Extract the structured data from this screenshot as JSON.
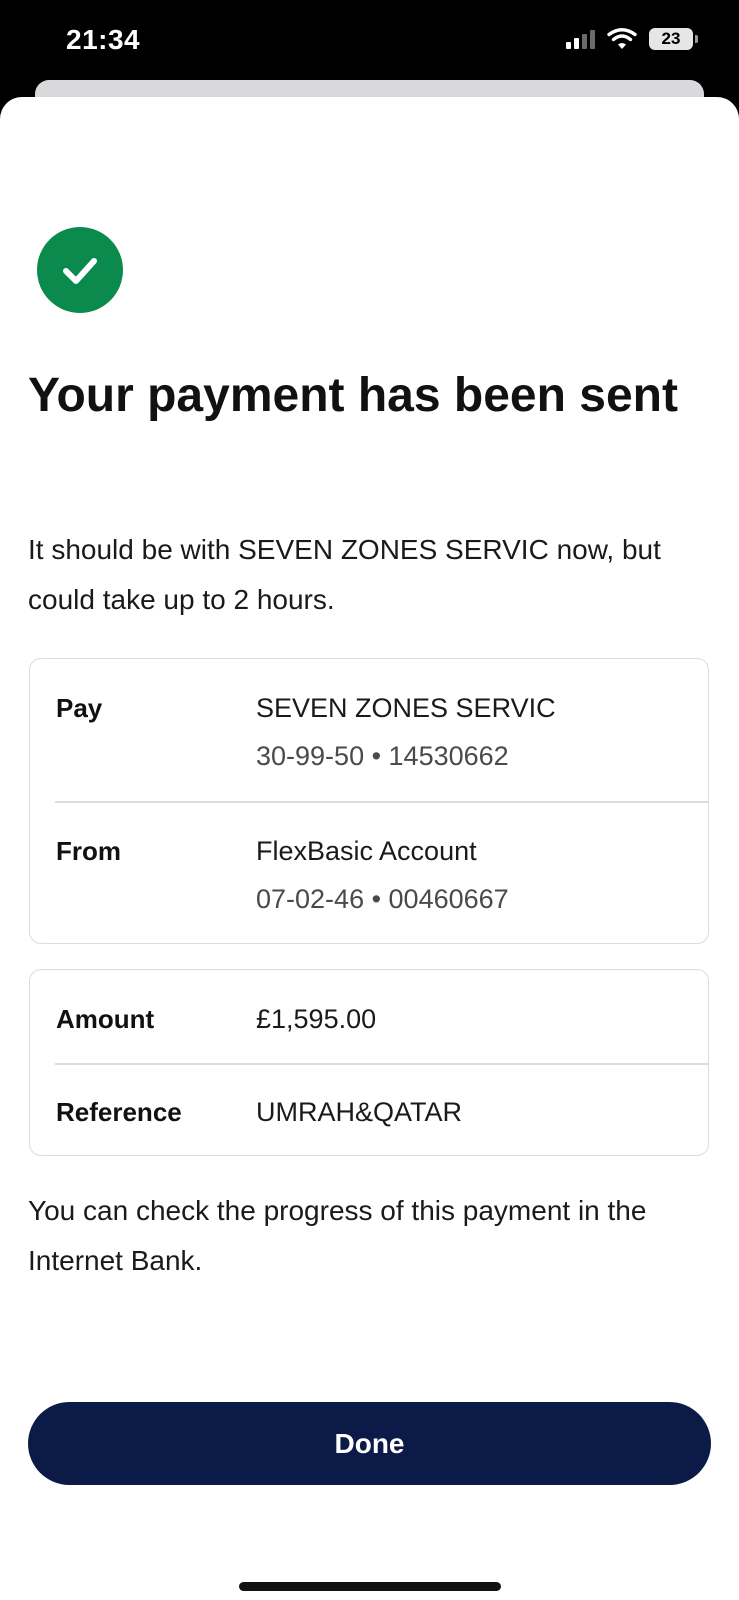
{
  "status_bar": {
    "time": "21:34",
    "battery": "23"
  },
  "confirmation": {
    "icon": "check-circle-icon",
    "title": "Your payment has been sent",
    "subtitle": "It should be with SEVEN ZONES SERVIC now, but could take up to 2 hours."
  },
  "details": {
    "pay": {
      "label": "Pay",
      "name": "SEVEN ZONES SERVIC",
      "account": "30-99-50 • 14530662"
    },
    "from": {
      "label": "From",
      "name": "FlexBasic Account",
      "account": "07-02-46 • 00460667"
    },
    "amount": {
      "label": "Amount",
      "value": "£1,595.00"
    },
    "reference": {
      "label": "Reference",
      "value": "UMRAH&QATAR"
    }
  },
  "footer_note": "You can check the progress of this payment in the Internet Bank.",
  "done_label": "Done",
  "colors": {
    "success": "#0a8a4c",
    "primary_button": "#0b1a47"
  }
}
